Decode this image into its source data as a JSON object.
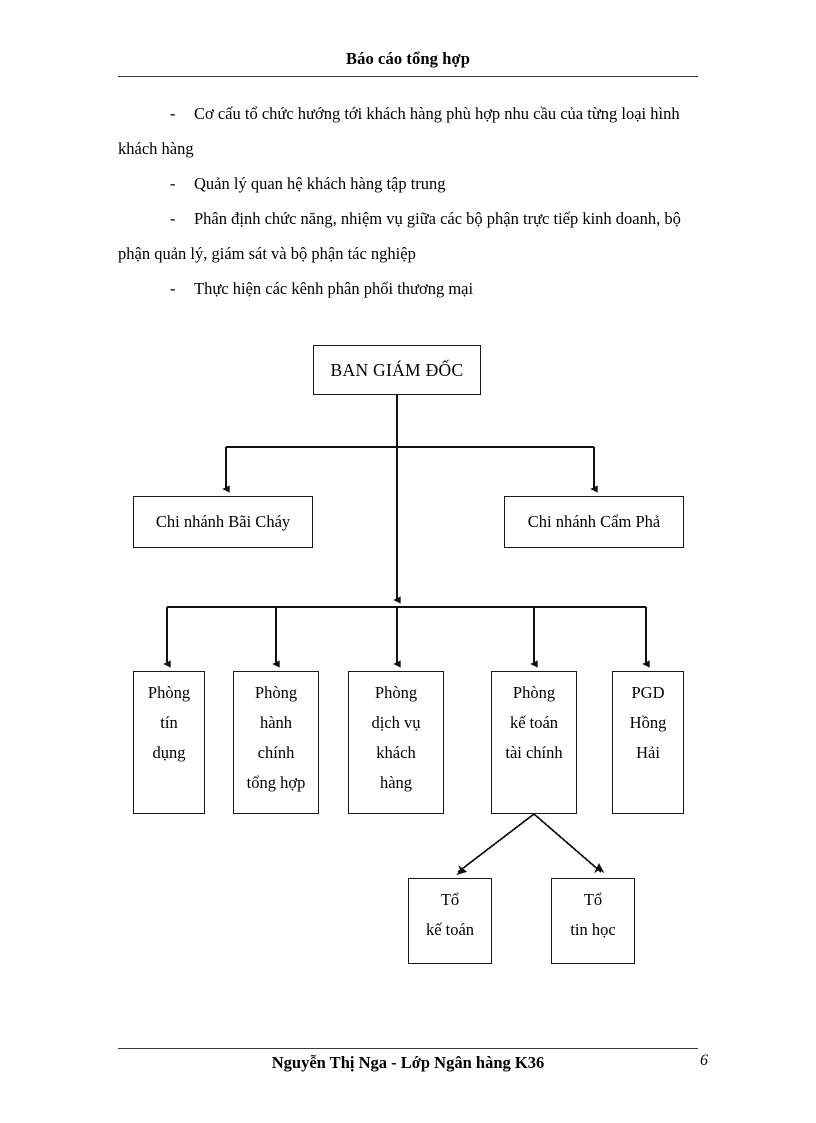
{
  "header": {
    "title": "Báo cáo tổng hợp"
  },
  "body": {
    "paragraphs": [
      "Cơ cấu tổ chức hướng tới khách hàng phù hợp nhu cầu của từng loại hình",
      "khách hàng",
      "Quản lý quan hệ khách hàng tập trung",
      "Phân định chức năng, nhiệm vụ giữa các bộ phận trực tiếp kinh doanh, bộ",
      "phận quản lý, giám sát và bộ phận tác nghiệp",
      "Thực hiện các kênh phân phối thương mại"
    ],
    "dash": "-"
  },
  "org_chart": {
    "root": {
      "label": "BAN GIÁM ĐỐC"
    },
    "branches": [
      {
        "label": "Chi nhánh Bãi Cháy"
      },
      {
        "label": "Chi nhánh Cẩm Phả"
      }
    ],
    "departments": [
      {
        "lines": [
          "Phòng",
          "tín",
          "dụng"
        ]
      },
      {
        "lines": [
          "Phòng",
          "hành",
          "chính",
          "tổng hợp"
        ]
      },
      {
        "lines": [
          "Phòng",
          "dịch vụ",
          "khách",
          "hàng"
        ]
      },
      {
        "lines": [
          "Phòng",
          "kế toán",
          "tài chính"
        ]
      },
      {
        "lines": [
          "PGD",
          "Hồng",
          "Hải"
        ]
      }
    ],
    "teams": [
      {
        "lines": [
          "Tổ",
          "kế toán"
        ]
      },
      {
        "lines": [
          "Tổ",
          "tin học"
        ]
      }
    ]
  },
  "footer": {
    "author_line": "Nguyễn Thị Nga - Lớp Ngân hàng K36",
    "page_number": "6"
  },
  "colors": {
    "ink": "#000000",
    "rule": "#3a3a3a",
    "box_border": "#1a1a1a",
    "paper": "#ffffff"
  }
}
